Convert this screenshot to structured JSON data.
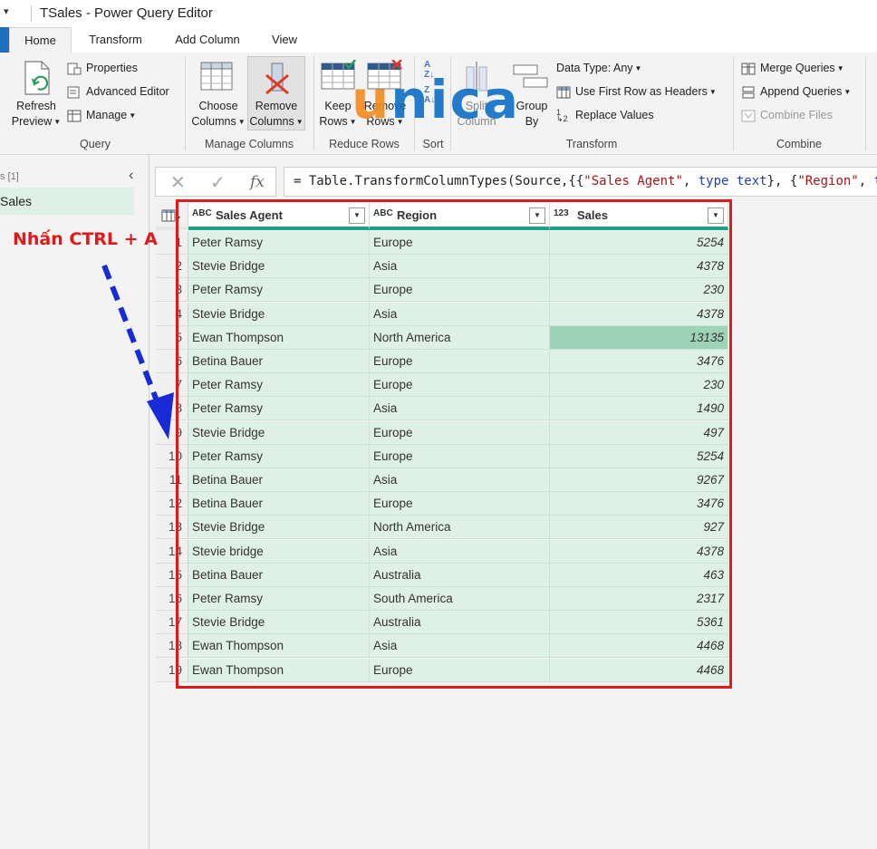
{
  "titlebar": {
    "quick_access": "▾",
    "title": "TSales - Power Query Editor"
  },
  "tabs": [
    {
      "label": "Home"
    },
    {
      "label": "Transform"
    },
    {
      "label": "Add Column"
    },
    {
      "label": "View"
    }
  ],
  "ribbon": {
    "query": {
      "refresh_preview": "Refresh\nPreview",
      "properties": "Properties",
      "advanced_editor": "Advanced Editor",
      "manage": "Manage",
      "group_label": "Query"
    },
    "manage_columns": {
      "choose_columns": "Choose\nColumns",
      "remove_columns": "Remove\nColumns",
      "group_label": "Manage Columns"
    },
    "reduce_rows": {
      "keep_rows": "Keep\nRows",
      "remove_rows": "Remove\nRows",
      "group_label": "Reduce Rows"
    },
    "sort": {
      "group_label": "Sort"
    },
    "transform": {
      "split_column": "Split\nColumn",
      "group_by": "Group\nBy",
      "data_type": "Data Type: Any",
      "use_first_row": "Use First Row as Headers",
      "replace_values": "Replace Values",
      "group_label": "Transform"
    },
    "combine": {
      "merge_queries": "Merge Queries",
      "append_queries": "Append Queries",
      "combine_files": "Combine Files",
      "group_label": "Combine"
    }
  },
  "watermark": {
    "text_u": "u",
    "text_rest": "nica"
  },
  "queries_pane": {
    "header": "s [1]",
    "item": "Sales"
  },
  "formula": {
    "prefix": "= Table.TransformColumnTypes(Source,{{",
    "s1": "\"Sales Agent\"",
    "mid1": ", ",
    "kw1": "type text",
    "mid2": "}, {",
    "s2": "\"Region\"",
    "mid3": ", ",
    "kw2": "ty"
  },
  "table": {
    "columns": [
      {
        "type_icon": "ABC",
        "name": "Sales Agent"
      },
      {
        "type_icon": "ABC",
        "name": "Region"
      },
      {
        "type_icon": "123",
        "name": "Sales"
      }
    ],
    "rows": [
      {
        "n": "1",
        "agent": "Peter Ramsy",
        "region": "Europe",
        "sales": "5254"
      },
      {
        "n": "2",
        "agent": "Stevie Bridge",
        "region": "Asia",
        "sales": "4378"
      },
      {
        "n": "3",
        "agent": "Peter Ramsy",
        "region": "Europe",
        "sales": "230"
      },
      {
        "n": "4",
        "agent": "Stevie Bridge",
        "region": "Asia",
        "sales": "4378"
      },
      {
        "n": "5",
        "agent": "Ewan Thompson",
        "region": "North America",
        "sales": "13135"
      },
      {
        "n": "6",
        "agent": "Betina Bauer",
        "region": "Europe",
        "sales": "3476"
      },
      {
        "n": "7",
        "agent": "Peter Ramsy",
        "region": "Europe",
        "sales": "230"
      },
      {
        "n": "8",
        "agent": "Peter Ramsy",
        "region": "Asia",
        "sales": "1490"
      },
      {
        "n": "9",
        "agent": "Stevie Bridge",
        "region": "Europe",
        "sales": "497"
      },
      {
        "n": "10",
        "agent": "Peter Ramsy",
        "region": "Europe",
        "sales": "5254"
      },
      {
        "n": "11",
        "agent": "Betina Bauer",
        "region": "Asia",
        "sales": "9267"
      },
      {
        "n": "12",
        "agent": "Betina Bauer",
        "region": "Europe",
        "sales": "3476"
      },
      {
        "n": "13",
        "agent": "Stevie Bridge",
        "region": "North America",
        "sales": "927"
      },
      {
        "n": "14",
        "agent": "Stevie bridge",
        "region": "Asia",
        "sales": "4378"
      },
      {
        "n": "15",
        "agent": "Betina Bauer",
        "region": "Australia",
        "sales": "463"
      },
      {
        "n": "16",
        "agent": "Peter Ramsy",
        "region": "South America",
        "sales": "2317"
      },
      {
        "n": "17",
        "agent": "Stevie Bridge",
        "region": "Australia",
        "sales": "5361"
      },
      {
        "n": "18",
        "agent": "Ewan Thompson",
        "region": "Asia",
        "sales": "4468"
      },
      {
        "n": "19",
        "agent": "Ewan Thompson",
        "region": "Europe",
        "sales": "4468"
      }
    ],
    "highlighted_row": "5"
  },
  "annotation": {
    "callout": "Nhấn CTRL + A"
  },
  "colors": {
    "accent": "#1f6fbf",
    "selection": "#dff0e6",
    "highlight": "#9fd3b8",
    "annotation_red": "#e0191b",
    "arrow_blue": "#1a2ad6",
    "header_underline": "#1aa38a"
  }
}
